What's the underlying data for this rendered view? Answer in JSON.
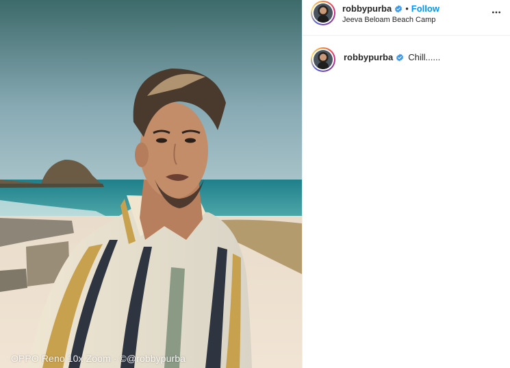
{
  "post": {
    "watermark": "OPPO Reno 10x Zoom · ©@robbypurba"
  },
  "header": {
    "username": "robbypurba",
    "separator": "•",
    "follow_label": "Follow",
    "location": "Jeeva Beloam Beach Camp",
    "more_icon": "more-horizontal-icon",
    "verified_icon": "verified-badge-icon"
  },
  "caption": {
    "username": "robbypurba",
    "text": "Chill......"
  },
  "colors": {
    "accent": "#0095f6",
    "verified": "#3897f0",
    "text": "#262626",
    "divider": "#efefef"
  }
}
